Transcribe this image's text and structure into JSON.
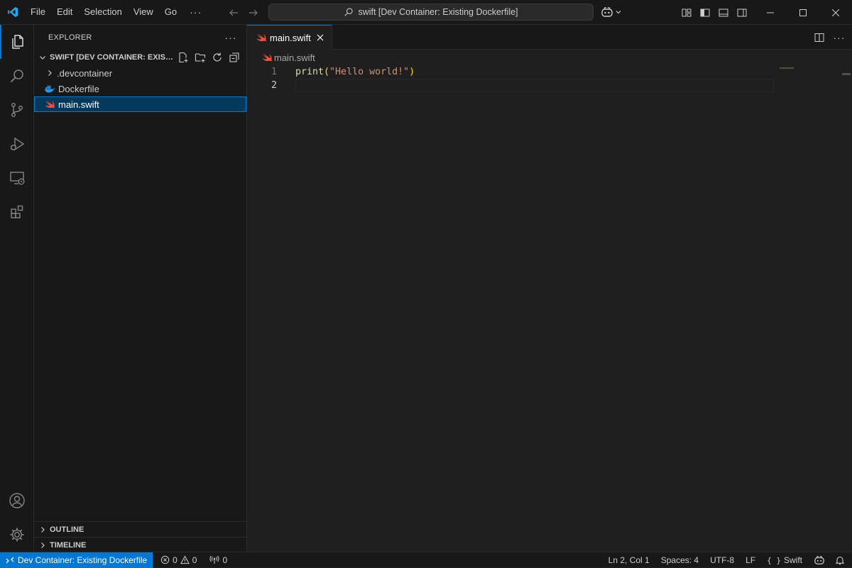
{
  "titlebar": {
    "menu": [
      "File",
      "Edit",
      "Selection",
      "View",
      "Go"
    ],
    "menu_more": "···",
    "command_center_text": "swift [Dev Container: Existing Dockerfile]"
  },
  "activity_bar": {
    "items": [
      "explorer-icon",
      "search-icon",
      "source-control-icon",
      "run-debug-icon",
      "remote-explorer-icon",
      "extensions-icon"
    ],
    "bottom": [
      "accounts-icon",
      "manage-gear-icon"
    ]
  },
  "sidebar": {
    "title": "EXPLORER",
    "more": "···",
    "folder_name": "SWIFT [DEV CONTAINER: EXISTING DOCKERFILE]",
    "tree": [
      {
        "label": ".devcontainer",
        "type": "folder"
      },
      {
        "label": "Dockerfile",
        "type": "docker"
      },
      {
        "label": "main.swift",
        "type": "swift",
        "selected": true
      }
    ],
    "outline": "OUTLINE",
    "timeline": "TIMELINE"
  },
  "editor": {
    "tab_label": "main.swift",
    "breadcrumb": "main.swift",
    "tab_more": "···",
    "lines": [
      {
        "num": "1",
        "fn": "print",
        "open": "(",
        "str": "\"Hello world!\"",
        "close": ")"
      },
      {
        "num": "2"
      }
    ]
  },
  "statusbar": {
    "remote": "Dev Container: Existing Dockerfile",
    "errors": "0",
    "warnings": "0",
    "ports": "0",
    "cursor": "Ln 2, Col 1",
    "spaces": "Spaces: 4",
    "encoding": "UTF-8",
    "eol": "LF",
    "language": "Swift",
    "language_icon": "{ }"
  },
  "colors": {
    "accent": "#0078d4",
    "swift": "#f05138",
    "docker": "#2496ed"
  }
}
